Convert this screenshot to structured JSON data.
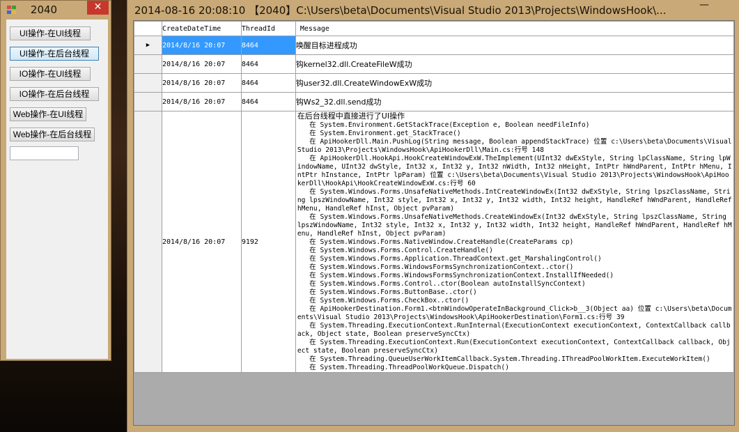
{
  "small_window": {
    "title": "2040",
    "close_glyph": "✕",
    "buttons": [
      "UI操作-在UI线程",
      "UI操作-在后台线程",
      "IO操作-在UI线程",
      "IO操作-在后台线程",
      "Web操作-在UI线程",
      "Web操作-在后台线程"
    ],
    "textbox_value": ""
  },
  "main_window": {
    "title": "2014-08-16 20:08:10    【2040】C:\\Users\\beta\\Documents\\Visual Studio 2013\\Projects\\WindowsHook\\...",
    "minimize_glyph": "—",
    "grid": {
      "columns": [
        "CreateDateTime",
        "ThreadId",
        "Message"
      ],
      "current_row_glyph": "▶",
      "rows": [
        {
          "date": "2014/8/16 20:07",
          "thread": "8464",
          "message": "唤醒目标进程成功"
        },
        {
          "date": "2014/8/16 20:07",
          "thread": "8464",
          "message": "钩kernel32.dll.CreateFileW成功"
        },
        {
          "date": "2014/8/16 20:07",
          "thread": "8464",
          "message": "钩user32.dll.CreateWindowExW成功"
        },
        {
          "date": "2014/8/16 20:07",
          "thread": "8464",
          "message": "钩Ws2_32.dll.send成功"
        }
      ],
      "big_row": {
        "date": "2014/8/16 20:07",
        "thread": "9192",
        "message_first": "在后台线程中直接进行了UI操作",
        "trace": "   在 System.Environment.GetStackTrace(Exception e, Boolean needFileInfo)\n   在 System.Environment.get_StackTrace()\n   在 ApiHookerDll.Main.PushLog(String message, Boolean appendStackTrace) 位置 c:\\Users\\beta\\Documents\\Visual Studio 2013\\Projects\\WindowsHook\\ApiHookerDll\\Main.cs:行号 148\n   在 ApiHookerDll.HookApi.HookCreateWindowExW.TheImplement(UInt32 dwExStyle, String lpClassName, String lpWindowName, UInt32 dwStyle, Int32 x, Int32 y, Int32 nWidth, Int32 nHeight, IntPtr hWndParent, IntPtr hMenu, IntPtr hInstance, IntPtr lpParam) 位置 c:\\Users\\beta\\Documents\\Visual Studio 2013\\Projects\\WindowsHook\\ApiHookerDll\\HookApi\\HookCreateWindowExW.cs:行号 60\n   在 System.Windows.Forms.UnsafeNativeMethods.IntCreateWindowEx(Int32 dwExStyle, String lpszClassName, String lpszWindowName, Int32 style, Int32 x, Int32 y, Int32 width, Int32 height, HandleRef hWndParent, HandleRef hMenu, HandleRef hInst, Object pvParam)\n   在 System.Windows.Forms.UnsafeNativeMethods.CreateWindowEx(Int32 dwExStyle, String lpszClassName, String lpszWindowName, Int32 style, Int32 x, Int32 y, Int32 width, Int32 height, HandleRef hWndParent, HandleRef hMenu, HandleRef hInst, Object pvParam)\n   在 System.Windows.Forms.NativeWindow.CreateHandle(CreateParams cp)\n   在 System.Windows.Forms.Control.CreateHandle()\n   在 System.Windows.Forms.Application.ThreadContext.get_MarshalingControl()\n   在 System.Windows.Forms.WindowsFormsSynchronizationContext..ctor()\n   在 System.Windows.Forms.WindowsFormsSynchronizationContext.InstallIfNeeded()\n   在 System.Windows.Forms.Control..ctor(Boolean autoInstallSyncContext)\n   在 System.Windows.Forms.ButtonBase..ctor()\n   在 System.Windows.Forms.CheckBox..ctor()\n   在 ApiHookerDestination.Form1.<btnWindowOperateInBackground_Click>b__3(Object aa) 位置 c:\\Users\\beta\\Documents\\Visual Studio 2013\\Projects\\WindowsHook\\ApiHookerDestination\\Form1.cs:行号 39\n   在 System.Threading.ExecutionContext.RunInternal(ExecutionContext executionContext, ContextCallback callback, Object state, Boolean preserveSyncCtx)\n   在 System.Threading.ExecutionContext.Run(ExecutionContext executionContext, ContextCallback callback, Object state, Boolean preserveSyncCtx)\n   在 System.Threading.QueueUserWorkItemCallback.System.Threading.IThreadPoolWorkItem.ExecuteWorkItem()\n   在 System.Threading.ThreadPoolWorkQueue.Dispatch()"
      }
    }
  },
  "colors": {
    "window_frame": "#c8a977",
    "close_button": "#c7382c",
    "selection": "#3399ff",
    "grid_background": "#ababab"
  }
}
